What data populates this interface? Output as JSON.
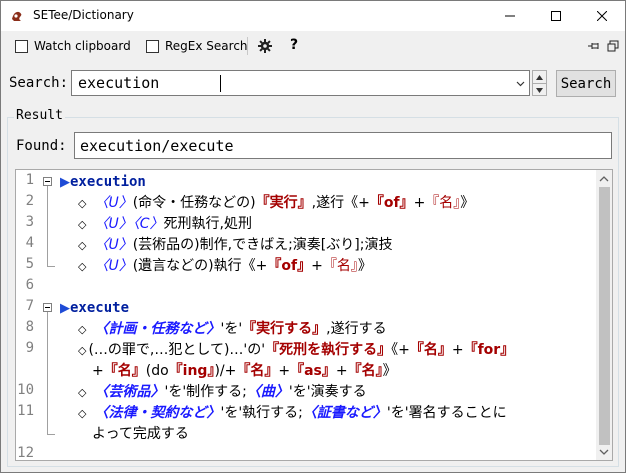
{
  "window": {
    "title": "SETee/Dictionary"
  },
  "toolbar": {
    "watch_clipboard": "Watch clipboard",
    "regex_search": "RegEx Search",
    "help": "?"
  },
  "search": {
    "label": "Search:",
    "value": "execution",
    "button": "Search"
  },
  "result": {
    "group_title": "Result",
    "found_label": "Found:",
    "found_value": "execution/execute",
    "line_numbers": [
      "1",
      "2",
      "3",
      "4",
      "5",
      "6",
      "7",
      "8",
      "9",
      "",
      "10",
      "11",
      "",
      "12"
    ],
    "entries": {
      "e1": {
        "tri": "▶",
        "hw": "execution"
      },
      "e2": {
        "dia": "◇",
        "m": "〈U〉",
        "t1": "(命令・任務などの)",
        "b1": "『実行』",
        "t2": ",遂行《+",
        "b2": "『of』",
        "t3": "+",
        "b3": "『名』",
        "t4": "》"
      },
      "e3": {
        "dia": "◇",
        "m": "〈U〉〈C〉",
        "t1": "死刑執行,処刑"
      },
      "e4": {
        "dia": "◇",
        "m": "〈U〉",
        "t1": "(芸術品の)制作,できばえ;演奏[ぶり];演技"
      },
      "e5": {
        "dia": "◇",
        "m": "〈U〉",
        "t1": "(遺言などの)執行《+",
        "b1": "『of』",
        "t2": "+",
        "b2": "『名』",
        "t3": "》"
      },
      "e7": {
        "tri": "▶",
        "hw": "execute"
      },
      "e8": {
        "dia": "◇",
        "m": "〈計画・任務など〉",
        "t1": "'を'",
        "b1": "『実行する』",
        "t2": ",遂行する"
      },
      "e9": {
        "dia": "◇",
        "t1": "(…の罪で,…犯として)…'の'",
        "b1": "『死刑を執行する』",
        "t2": "《+",
        "b2": "『名』",
        "t3": "+",
        "b3": "『for』"
      },
      "e9b": {
        "t1": "+",
        "b1": "『名』",
        "t2": "(do",
        "b2": "『ing』",
        "t3": ")/+",
        "b3": "『名』",
        "t4": "+",
        "b4": "『as』",
        "t5": "+",
        "b5": "『名』",
        "t6": "》"
      },
      "e10": {
        "dia": "◇",
        "m": "〈芸術品〉",
        "t1": "'を'制作する;",
        "m2": "〈曲〉",
        "t2": "'を'演奏する"
      },
      "e11": {
        "dia": "◇",
        "m": "〈法律・契約など〉",
        "t1": "'を'執行する;",
        "m2": "〈証書など〉",
        "t2": "'を'署名することに"
      },
      "e11b": {
        "t1": "よって完成する"
      }
    }
  }
}
